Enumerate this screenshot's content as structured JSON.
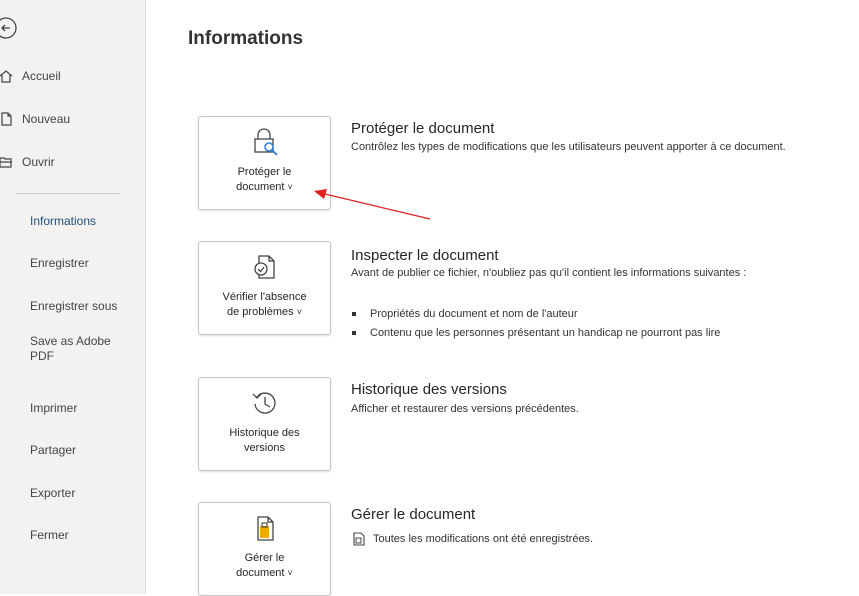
{
  "sidebar": {
    "top_items": [
      {
        "label": "Accueil",
        "icon": "home-icon"
      },
      {
        "label": "Nouveau",
        "icon": "new-document-icon"
      },
      {
        "label": "Ouvrir",
        "icon": "open-folder-icon"
      }
    ],
    "items": [
      {
        "label": "Informations",
        "active": true
      },
      {
        "label": "Enregistrer"
      },
      {
        "label": "Enregistrer sous"
      },
      {
        "label": "Save as Adobe PDF"
      },
      {
        "label": "Imprimer"
      },
      {
        "label": "Partager"
      },
      {
        "label": "Exporter"
      },
      {
        "label": "Fermer"
      }
    ]
  },
  "main": {
    "title": "Informations",
    "sections": [
      {
        "card_line1": "Protéger le",
        "card_line2": "document",
        "card_chevron": "˅",
        "icon": "lock-search-icon",
        "heading": "Protéger le document",
        "description": "Contrôlez les types de modifications que les utilisateurs peuvent apporter à ce document."
      },
      {
        "card_line1": "Vérifier l'absence",
        "card_line2": "de problèmes",
        "card_chevron": "˅",
        "icon": "document-check-icon",
        "heading": "Inspecter le document",
        "description": "Avant de publier ce fichier, n'oubliez pas qu'il contient les informations suivantes :",
        "bullets": [
          "Propriétés du document et nom de l'auteur",
          "Contenu que les personnes présentant un handicap ne pourront pas lire"
        ]
      },
      {
        "card_line1": "Historique des",
        "card_line2": "versions",
        "icon": "history-icon",
        "heading": "Historique des versions",
        "description": "Afficher et restaurer des versions précédentes."
      },
      {
        "card_line1": "Gérer le",
        "card_line2": "document",
        "card_chevron": "˅",
        "icon": "manage-document-icon",
        "heading": "Gérer le document",
        "description": "Toutes les modifications ont été enregistrées."
      }
    ]
  },
  "colors": {
    "sidebar_bg": "#f3f2f1",
    "active_nav": "#1f4e79",
    "annotation_arrow": "#e02020",
    "manage_icon_accent": "#f2a900",
    "protect_icon_accent": "#2b7cd3"
  }
}
